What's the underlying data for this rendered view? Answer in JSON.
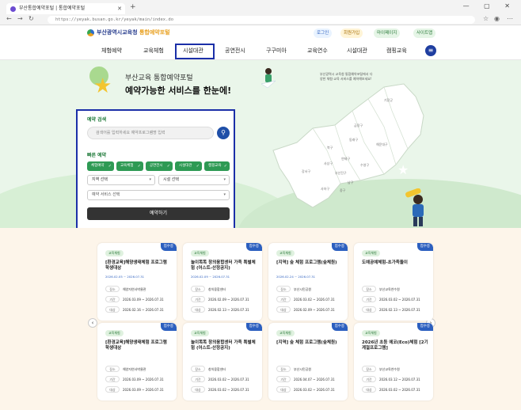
{
  "browser": {
    "tab_title": "부산통합예약포털 | 통합예약포털",
    "address": "https://yeyak.busan.go.kr/yeyak/main/index.do",
    "new_tab": "+",
    "window_controls": "—  ▢  ✕"
  },
  "header": {
    "logo_org": "부산광역시교육청",
    "logo_service": "통합예약포털",
    "links": [
      "로그인",
      "회원가입",
      "마이페이지",
      "사이트맵"
    ]
  },
  "gnb": {
    "items": [
      "체험예약",
      "교육체험",
      "시설대관",
      "공연전시",
      "구구미아",
      "교육연수",
      "시설대관",
      "캠핑교육"
    ],
    "active_index": 2
  },
  "hero": {
    "subtitle": "부산교육 통합예약포털",
    "title": "예약가능한 서비스를 한눈에!",
    "desc": "부산광역시 교육청 통합예약포털에서 다양한 체험·교육 서비스를 예약해보세요!"
  },
  "panel": {
    "search_heading": "예약 검색",
    "search_placeholder": "검색어를 입력하세요 예약프로그램명 입력",
    "quick_heading": "빠른 예약",
    "chips": [
      "체험예약",
      "교육체험",
      "공연전시",
      "시설대관",
      "캠핑교육"
    ],
    "region_select": "지역 선택",
    "district_select": "시설 선택",
    "service_select": "예약 서비스 선택",
    "cta": "예약하기"
  },
  "nav": {
    "prev": "‹",
    "next": "›"
  },
  "cards": [
    {
      "badge": "교육체험",
      "status": "접수중",
      "title": "[환경교육]해양생태체험 프로그램 학생대상",
      "meta": "2026.02.05 ~ 2026.07.31",
      "rows": [
        [
          "장소",
          "해양자연사박물관"
        ],
        [
          "기간",
          "2026.03.09 ~ 2026.07.31"
        ],
        [
          "대상",
          "2026.02.16 ~ 2026.07.31"
        ]
      ]
    },
    {
      "badge": "교육체험",
      "status": "접수중",
      "title": "놀이똑똑 창의융합센터 가족 특별체험 (어스트-산정공지)",
      "meta": "2026.02.09 ~ 2026.07.31",
      "rows": [
        [
          "장소",
          "창의융합센터"
        ],
        [
          "기간",
          "2026.02.09 ~ 2026.07.31"
        ],
        [
          "대상",
          "2026.02.13 ~ 2026.07.31"
        ]
      ]
    },
    {
      "badge": "교육체험",
      "status": "접수중",
      "title": "[지역] 숲 체험 프로그램(숲체원)",
      "meta": "2026.02.24 ~ 2026.07.31",
      "rows": [
        [
          "장소",
          "부산시민공원"
        ],
        [
          "기간",
          "2026.03.02 ~ 2026.07.31"
        ],
        [
          "대상",
          "2026.02.09 ~ 2026.07.31"
        ]
      ]
    },
    {
      "badge": "교육체험",
      "status": "접수중",
      "title": "도예공예체험-초가족돌이",
      "meta": "",
      "rows": [
        [
          "장소",
          "부산교육연수원"
        ],
        [
          "기간",
          "2026.03.02 ~ 2026.07.31"
        ],
        [
          "대상",
          "2026.02.13 ~ 2026.07.31"
        ]
      ]
    },
    {
      "badge": "교육체험",
      "status": "접수중",
      "title": "[환경교육]해양생태체험 프로그램 학생대상",
      "meta": "",
      "rows": [
        [
          "장소",
          "해양자연사박물관"
        ],
        [
          "기간",
          "2026.03.09 ~ 2026.07.31"
        ],
        [
          "대상",
          "2026.03.09 ~ 2026.07.31"
        ]
      ]
    },
    {
      "badge": "교육체험",
      "status": "접수중",
      "title": "놀이똑똑 창의융합센터 가족 특별체험 (어스트-산정공지)",
      "meta": "",
      "rows": [
        [
          "장소",
          "창의융합센터"
        ],
        [
          "기간",
          "2026.03.02 ~ 2026.07.31"
        ],
        [
          "대상",
          "2026.03.02 ~ 2026.07.31"
        ]
      ]
    },
    {
      "badge": "교육체험",
      "status": "접수중",
      "title": "[지역] 숲 체험 프로그램(숲체원)",
      "meta": "",
      "rows": [
        [
          "장소",
          "부산시민공원"
        ],
        [
          "기간",
          "2026.04.07 ~ 2026.07.31"
        ],
        [
          "대상",
          "2026.03.02 ~ 2026.07.31"
        ]
      ]
    },
    {
      "badge": "교육체험",
      "status": "접수중",
      "title": "2026년 초등 에코(Eco)체험 [2기 계절프로그램]",
      "meta": "",
      "rows": [
        [
          "장소",
          "부산교육연수원"
        ],
        [
          "기간",
          "2026.03.12 ~ 2026.07.31"
        ],
        [
          "대상",
          "2026.03.02 ~ 2026.07.31"
        ]
      ]
    }
  ],
  "colors": {
    "accent": "#1b2fa8",
    "green": "#2e9a54",
    "status": "#2c5fbf"
  }
}
